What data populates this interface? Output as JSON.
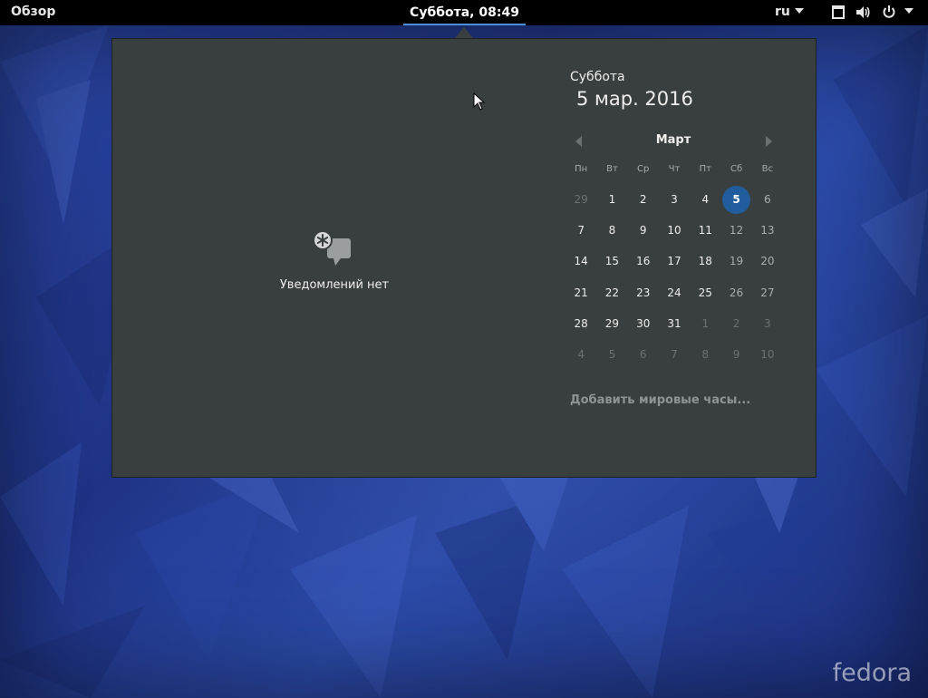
{
  "topbar": {
    "activities_label": "Обзор",
    "clock_label": "Суббота, 08:49",
    "language_label": "ru",
    "icons": [
      "window-icon",
      "volume-icon",
      "power-icon"
    ]
  },
  "notifications": {
    "empty_label": "Уведомлений нет",
    "icon": "notifications-icon"
  },
  "date": {
    "weekday": "Суббота",
    "full_date": "5 мар. 2016"
  },
  "calendar": {
    "month": "Март",
    "day_headers": [
      "Пн",
      "Вт",
      "Ср",
      "Чт",
      "Пт",
      "Сб",
      "Вс"
    ],
    "weeks": [
      [
        "29",
        "1",
        "2",
        "3",
        "4",
        "5",
        "6"
      ],
      [
        "7",
        "8",
        "9",
        "10",
        "11",
        "12",
        "13"
      ],
      [
        "14",
        "15",
        "16",
        "17",
        "18",
        "19",
        "20"
      ],
      [
        "21",
        "22",
        "23",
        "24",
        "25",
        "26",
        "27"
      ],
      [
        "28",
        "29",
        "30",
        "31",
        "1",
        "2",
        "3"
      ],
      [
        "4",
        "5",
        "6",
        "7",
        "8",
        "9",
        "10"
      ]
    ],
    "selected_day": "5",
    "accent_color": "#215d9c"
  },
  "world_clocks": {
    "add_label": "Добавить мировые часы..."
  },
  "wallpaper": {
    "brand": "fedora",
    "base_color": "#243a8e"
  }
}
